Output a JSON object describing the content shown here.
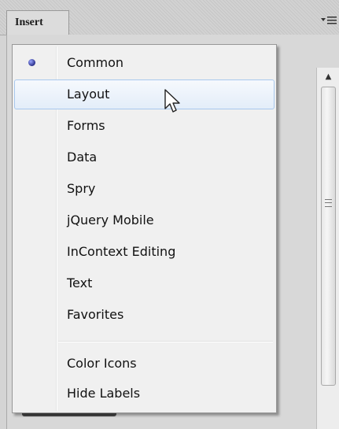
{
  "panel": {
    "tab_label": "Insert",
    "menu_icon": "panel-options-menu-icon"
  },
  "menu": {
    "items": [
      {
        "label": "Common",
        "checked": true
      },
      {
        "label": "Layout",
        "highlighted": true
      },
      {
        "label": "Forms"
      },
      {
        "label": "Data"
      },
      {
        "label": "Spry"
      },
      {
        "label": "jQuery Mobile"
      },
      {
        "label": "InContext Editing"
      },
      {
        "label": "Text"
      },
      {
        "label": "Favorites"
      }
    ],
    "options": [
      {
        "label": "Color Icons"
      },
      {
        "label": "Hide Labels"
      }
    ]
  },
  "colors": {
    "highlight_border": "#a8c8ee",
    "menu_background": "#f0f0f0",
    "radio_dot": "#2a2f8a"
  },
  "icons": {
    "selected_marker": "radio-dot-icon",
    "cursor": "mouse-pointer-icon",
    "scroll_up": "scroll-up-arrow-icon"
  }
}
